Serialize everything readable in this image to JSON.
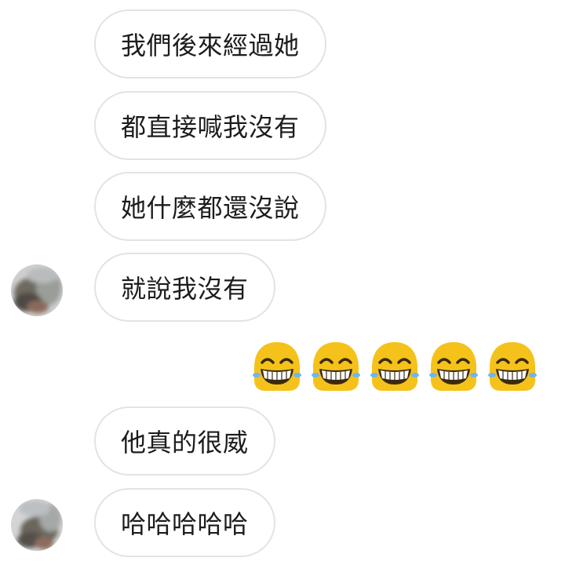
{
  "messages": [
    {
      "text": "我們後來經過她"
    },
    {
      "text": "都直接喊我沒有"
    },
    {
      "text": "她什麼都還沒說"
    },
    {
      "text": "就說我沒有"
    },
    {
      "text": "他真的很威"
    },
    {
      "text": "哈哈哈哈哈"
    }
  ],
  "emoji_reply": {
    "emoji": "grinning-face-with-tears-of-joy",
    "count": 5,
    "color": "#f5c21b"
  },
  "colors": {
    "bubble_border": "#e3e3e3",
    "bubble_text": "#1c1c1c",
    "background": "#ffffff"
  }
}
